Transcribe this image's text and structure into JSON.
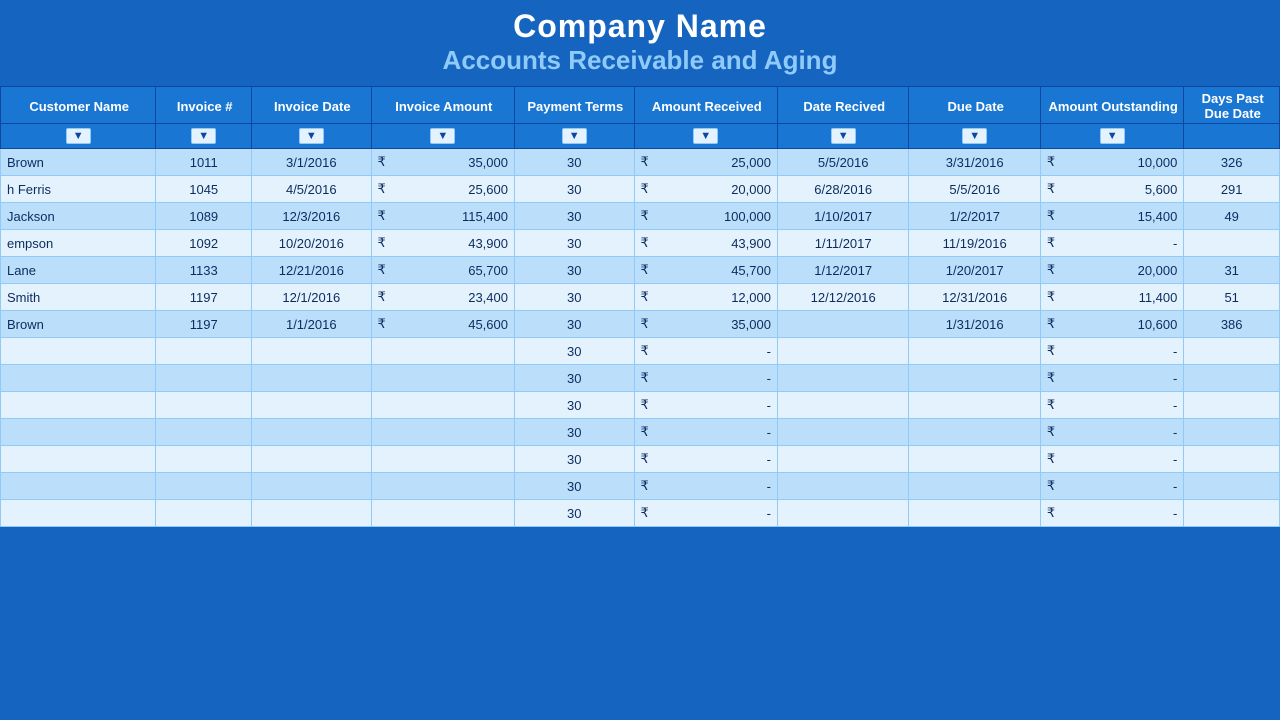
{
  "header": {
    "company": "Company Name",
    "subtitle": "Accounts Receivable and Aging"
  },
  "columns": [
    {
      "key": "customer",
      "label": "Customer Name",
      "class": "col-customer"
    },
    {
      "key": "invoice_num",
      "label": "Invoice #",
      "class": "col-invoice-num"
    },
    {
      "key": "invoice_date",
      "label": "Invoice Date",
      "class": "col-invoice-date"
    },
    {
      "key": "invoice_amount",
      "label": "Invoice Amount",
      "class": "col-invoice-amount"
    },
    {
      "key": "payment_terms",
      "label": "Payment Terms",
      "class": "col-payment-terms"
    },
    {
      "key": "amount_received",
      "label": "Amount Received",
      "class": "col-amount-received"
    },
    {
      "key": "date_received",
      "label": "Date Recived",
      "class": "col-date-received"
    },
    {
      "key": "due_date",
      "label": "Due Date",
      "class": "col-due-date"
    },
    {
      "key": "amount_outstanding",
      "label": "Amount Outstanding",
      "class": "col-amount-outstanding"
    },
    {
      "key": "days_due",
      "label": "Days Past Due Date",
      "class": "col-days-due"
    }
  ],
  "rows": [
    {
      "customer": "Brown",
      "invoice_num": "1011",
      "invoice_date": "3/1/2016",
      "invoice_amount": "35,000",
      "payment_terms": "30",
      "amount_received": "25,000",
      "date_received": "5/5/2016",
      "due_date": "3/31/2016",
      "amount_outstanding": "10,000",
      "days_due": "326"
    },
    {
      "customer": "h Ferris",
      "invoice_num": "1045",
      "invoice_date": "4/5/2016",
      "invoice_amount": "25,600",
      "payment_terms": "30",
      "amount_received": "20,000",
      "date_received": "6/28/2016",
      "due_date": "5/5/2016",
      "amount_outstanding": "5,600",
      "days_due": "291"
    },
    {
      "customer": "Jackson",
      "invoice_num": "1089",
      "invoice_date": "12/3/2016",
      "invoice_amount": "115,400",
      "payment_terms": "30",
      "amount_received": "100,000",
      "date_received": "1/10/2017",
      "due_date": "1/2/2017",
      "amount_outstanding": "15,400",
      "days_due": "49"
    },
    {
      "customer": "empson",
      "invoice_num": "1092",
      "invoice_date": "10/20/2016",
      "invoice_amount": "43,900",
      "payment_terms": "30",
      "amount_received": "43,900",
      "date_received": "1/11/2017",
      "due_date": "11/19/2016",
      "amount_outstanding": "-",
      "days_due": ""
    },
    {
      "customer": "Lane",
      "invoice_num": "1133",
      "invoice_date": "12/21/2016",
      "invoice_amount": "65,700",
      "payment_terms": "30",
      "amount_received": "45,700",
      "date_received": "1/12/2017",
      "due_date": "1/20/2017",
      "amount_outstanding": "20,000",
      "days_due": "31"
    },
    {
      "customer": "Smith",
      "invoice_num": "1197",
      "invoice_date": "12/1/2016",
      "invoice_amount": "23,400",
      "payment_terms": "30",
      "amount_received": "12,000",
      "date_received": "12/12/2016",
      "due_date": "12/31/2016",
      "amount_outstanding": "11,400",
      "days_due": "51"
    },
    {
      "customer": "Brown",
      "invoice_num": "1197",
      "invoice_date": "1/1/2016",
      "invoice_amount": "45,600",
      "payment_terms": "30",
      "amount_received": "35,000",
      "date_received": "",
      "due_date": "1/31/2016",
      "amount_outstanding": "10,600",
      "days_due": "386"
    },
    {
      "customer": "",
      "invoice_num": "",
      "invoice_date": "",
      "invoice_amount": "",
      "payment_terms": "30",
      "amount_received": "-",
      "date_received": "",
      "due_date": "",
      "amount_outstanding": "-",
      "days_due": ""
    },
    {
      "customer": "",
      "invoice_num": "",
      "invoice_date": "",
      "invoice_amount": "",
      "payment_terms": "30",
      "amount_received": "-",
      "date_received": "",
      "due_date": "",
      "amount_outstanding": "-",
      "days_due": ""
    },
    {
      "customer": "",
      "invoice_num": "",
      "invoice_date": "",
      "invoice_amount": "",
      "payment_terms": "30",
      "amount_received": "-",
      "date_received": "",
      "due_date": "",
      "amount_outstanding": "-",
      "days_due": ""
    },
    {
      "customer": "",
      "invoice_num": "",
      "invoice_date": "",
      "invoice_amount": "",
      "payment_terms": "30",
      "amount_received": "-",
      "date_received": "",
      "due_date": "",
      "amount_outstanding": "-",
      "days_due": ""
    },
    {
      "customer": "",
      "invoice_num": "",
      "invoice_date": "",
      "invoice_amount": "",
      "payment_terms": "30",
      "amount_received": "-",
      "date_received": "",
      "due_date": "",
      "amount_outstanding": "-",
      "days_due": ""
    },
    {
      "customer": "",
      "invoice_num": "",
      "invoice_date": "",
      "invoice_amount": "",
      "payment_terms": "30",
      "amount_received": "-",
      "date_received": "",
      "due_date": "",
      "amount_outstanding": "-",
      "days_due": ""
    },
    {
      "customer": "",
      "invoice_num": "",
      "invoice_date": "",
      "invoice_amount": "",
      "payment_terms": "30",
      "amount_received": "-",
      "date_received": "",
      "due_date": "",
      "amount_outstanding": "-",
      "days_due": ""
    }
  ],
  "rupee_symbol": "₹",
  "dropdown_icon": "▼"
}
